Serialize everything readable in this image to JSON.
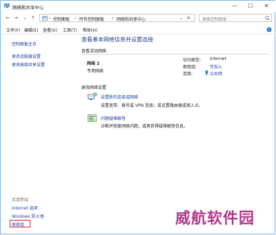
{
  "window": {
    "title": "网络和共享中心",
    "controls": {
      "minimize": "—",
      "maximize": "☐",
      "close": "✕"
    }
  },
  "addressbar": {
    "crumbs": [
      "控制面板",
      "所有控制面板",
      "网络和共享中心"
    ],
    "search_placeholder": "搜索控制面板"
  },
  "menubar": [
    "文件(F)",
    "编辑(E)",
    "查看(V)",
    "工具(T)",
    "帮助(H)"
  ],
  "sidebar": {
    "items": [
      "控制面板主页",
      "更改适配器设置",
      "更改高级共享设置"
    ],
    "see_also_title": "另请参阅",
    "see_also": [
      "Internet 选项",
      "Windows 防火墙",
      "家庭组"
    ]
  },
  "main": {
    "title": "查看基本网络信息并设置连接",
    "active_networks_label": "查看活动网络",
    "network_name": "网络 2",
    "network_type": "专用网络",
    "access_type_label": "访问类型:",
    "access_type_value": "Internet",
    "homegroup_label": "家庭组:",
    "homegroup_value": "可加入",
    "connections_label": "连接:",
    "connections_value": "以太网",
    "change_settings_label": "更改网络设置",
    "actions": [
      {
        "title": "设置新的连接或网络",
        "desc": "设置宽带、拨号或 VPN 连接；或设置路由器或接入点。"
      },
      {
        "title": "问题疑难解答",
        "desc": "诊断并修复网络问题，或者获得疑难解答信息。"
      }
    ]
  },
  "watermark": "威航软件园",
  "colors": {
    "link": "#1a3fa0",
    "title": "#1f3f8f",
    "highlight": "#d62020",
    "watermark": "#b03a8c"
  }
}
